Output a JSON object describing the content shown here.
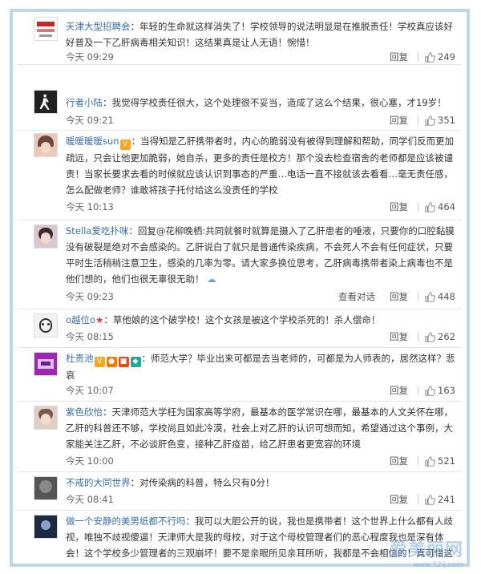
{
  "comments": [
    {
      "user": "天津大型招聘会",
      "text": "：年轻的生命就这样消失了！学校领导的说法明显是在推脱责任！学校真应该好好普及一下乙肝病毒相关知识！这结果真是让人无语！惋惜！",
      "time": "今天 09:29",
      "reply": "回复",
      "likes": "249",
      "avatar_color": "#c62828"
    },
    {
      "user": "行者小陆",
      "text": "：我觉得学校责任很大，这个处理很不妥当，造成了这么个结果，很心塞，才19岁！",
      "time": "今天 09:21",
      "reply": "回复",
      "likes": "351",
      "avatar_color": "#222222"
    },
    {
      "user": "暖暖暖暖sun",
      "text": "：当得知是乙肝携带者时，内心的脆弱没有被得到理解和帮助，同学们反而更加疏远，只会让他更加脆弱，她自杀，更多的责任是校方！那个没去检查宿舍的老师都是应该被谴责！当家长要求去看的时候就应该认识到事态的严重…电话一直不接就该去看看…毫无责任感，怎么配做老师？谁敢将孩子托付给这么没责任的学校",
      "time": "今天 10:13",
      "reply": "回复",
      "likes": "464",
      "avatar_color": "#b07a6a"
    },
    {
      "user": "Stella爱吃扑咪",
      "text": "：回复@花柳晚栖:共同就餐时就算是摄入了乙肝患者的唾液，只要你的口腔黏膜没有破裂是绝对不会感染的。乙肝说白了就只是普通传染疾病，不会死人不会有任何症状，只要平时生活稍稍注意卫生，感染的几率为零。请大家多换位思考，乙肝病毒携带者染上病毒也不是他们想的，他们也很无辜很无助！",
      "time": "今天 09:23",
      "view": "查看对话",
      "reply": "回复",
      "likes": "448",
      "avatar_color": "#7a5a6e"
    },
    {
      "user": "o越位o",
      "text": "：草他娘的这个破学校！这个女孩是被这个学校杀死的！杀人偿命！",
      "time": "今天 08:15",
      "reply": "回复",
      "likes": "262",
      "avatar_color": "#dddddd"
    },
    {
      "user": "杜贵池",
      "text": "：师范大学？毕业出来可都是去当老师的，可都是为人师表的，居然这样？悲哀",
      "time": "今天 10:07",
      "reply": "回复",
      "likes": "163",
      "avatar_color": "#9c27b0"
    },
    {
      "user": "紫色欣怡",
      "text": "：天津师范大学枉为国家高等学府，最基本的医学常识在哪，最基本的人文关怀在哪，乙肝的科普还不够，学校尚且如此冷漠，社会上对乙肝的认识可想而知，希望通过这个事例，大家能关注乙肝，不必谈肝色变，接种乙肝疫苗，给乙肝患者更宽容的环境",
      "time": "今天 10:00",
      "reply": "回复",
      "likes": "521",
      "avatar_color": "#c48a7a"
    },
    {
      "user": "不戒的大同世界",
      "text": "：对传染病的科普，特么只有0分！",
      "time": "今天 08:41",
      "reply": "回复",
      "likes": "241",
      "avatar_color": "#444444"
    },
    {
      "user": "做一个安静的美男纸都不行吗",
      "text": "：我可以大胆公开的说，我也是携带者！这个世界上什么都有人歧视，唯独不歧视傻逼！天津师大是我的母校，对于这个母校管理者们的恶心程度我也是深有体会！这个学校多少管理者的三观崩坏！要不是亲眼所见亲耳所听，我都是不会相信的！真可惜这么一条年轻的生",
      "time": "",
      "reply": "",
      "likes": "",
      "avatar_color": "#2a3a5a"
    }
  ],
  "watermark": {
    "main": "爱美丽网",
    "sub": "www.52ij.com"
  }
}
